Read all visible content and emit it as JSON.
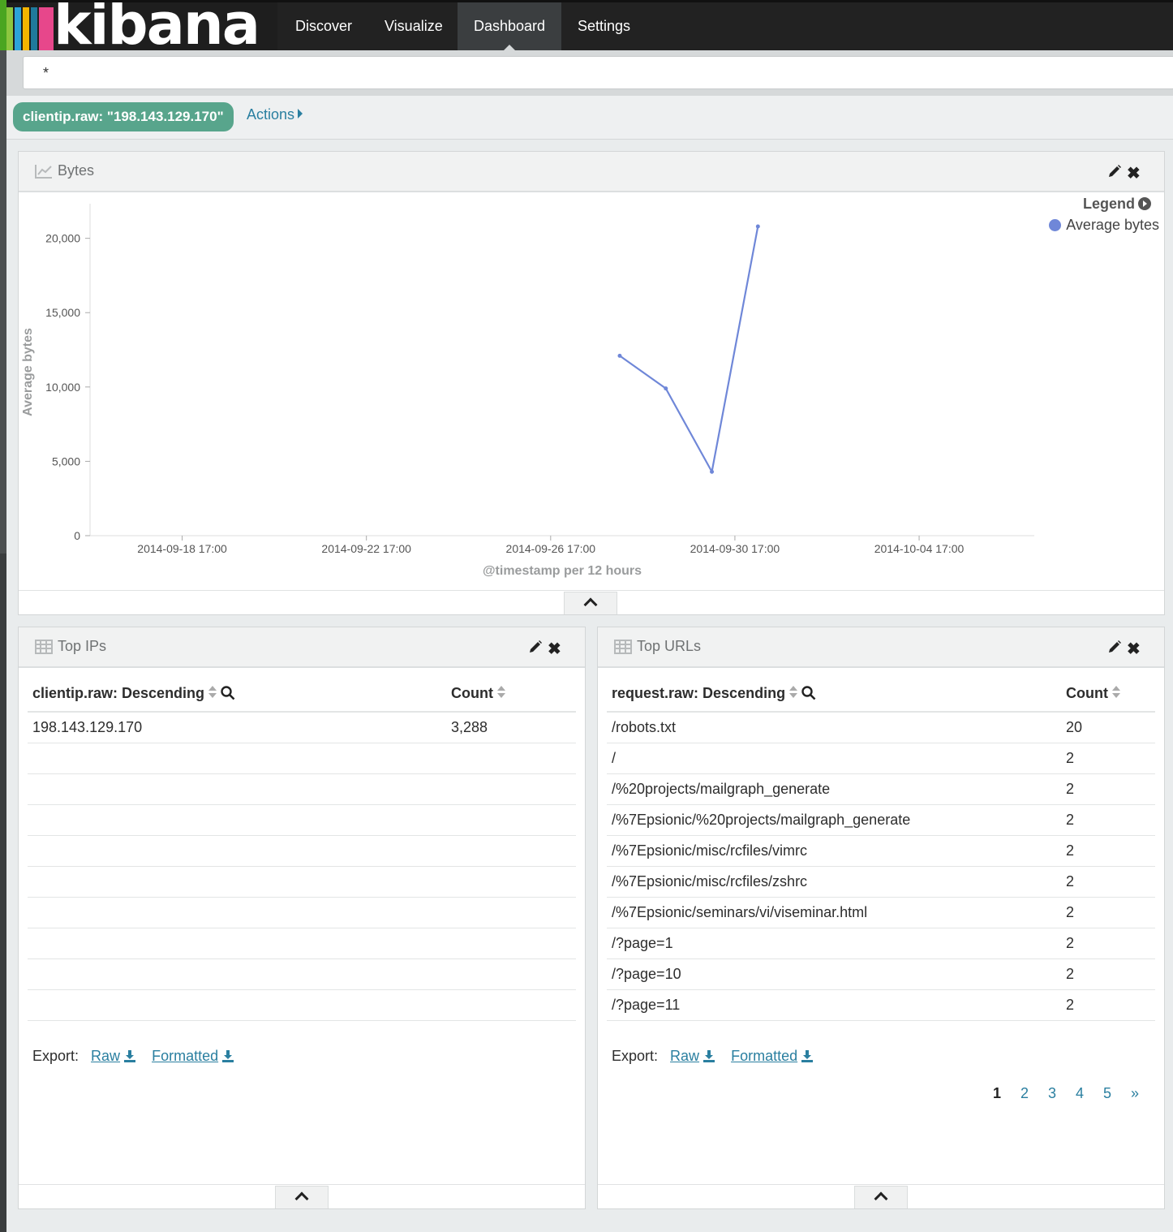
{
  "app": {
    "logo": "kibana"
  },
  "nav": {
    "items": [
      "Discover",
      "Visualize",
      "Dashboard",
      "Settings"
    ],
    "active": "Dashboard"
  },
  "query": {
    "value": "*"
  },
  "filter": {
    "pill": "clientip.raw: \"198.143.129.170\"",
    "actions": "Actions"
  },
  "bytes_panel": {
    "title": "Bytes",
    "legend_title": "Legend",
    "legend_item": "Average bytes"
  },
  "chart_data": {
    "type": "line",
    "title": "Bytes",
    "xlabel": "@timestamp per 12 hours",
    "ylabel": "Average bytes",
    "ylim": [
      0,
      22000
    ],
    "yticks": [
      "0",
      "5,000",
      "10,000",
      "15,000",
      "20,000"
    ],
    "ytick_values": [
      0,
      5000,
      10000,
      15000,
      20000
    ],
    "xticks": [
      "2014-09-18 17:00",
      "2014-09-22 17:00",
      "2014-09-26 17:00",
      "2014-09-30 17:00",
      "2014-10-04 17:00"
    ],
    "xlim": [
      "2014-09-16 17:00",
      "2014-10-07 05:00"
    ],
    "legend": "top-right",
    "series": [
      {
        "name": "Average bytes",
        "color": "#6f87d8",
        "x": [
          "2014-09-28 05:00",
          "2014-09-29 05:00",
          "2014-09-30 05:00",
          "2014-10-01 05:00"
        ],
        "y": [
          12100,
          9900,
          4300,
          20800
        ]
      }
    ]
  },
  "top_ips": {
    "title": "Top IPs",
    "columns": [
      "clientip.raw: Descending",
      "Count"
    ],
    "rows": [
      [
        "198.143.129.170",
        "3,288"
      ]
    ],
    "export_label": "Export:",
    "export_raw": "Raw",
    "export_formatted": "Formatted"
  },
  "top_urls": {
    "title": "Top URLs",
    "columns": [
      "request.raw: Descending",
      "Count"
    ],
    "rows": [
      [
        "/robots.txt",
        "20"
      ],
      [
        "/",
        "2"
      ],
      [
        "/%20projects/mailgraph_generate",
        "2"
      ],
      [
        "/%7Epsionic/%20projects/mailgraph_generate",
        "2"
      ],
      [
        "/%7Epsionic/misc/rcfiles/vimrc",
        "2"
      ],
      [
        "/%7Epsionic/misc/rcfiles/zshrc",
        "2"
      ],
      [
        "/%7Epsionic/seminars/vi/viseminar.html",
        "2"
      ],
      [
        "/?page=1",
        "2"
      ],
      [
        "/?page=10",
        "2"
      ],
      [
        "/?page=11",
        "2"
      ]
    ],
    "export_label": "Export:",
    "export_raw": "Raw",
    "export_formatted": "Formatted",
    "pages": [
      "1",
      "2",
      "3",
      "4",
      "5",
      "»"
    ],
    "current_page": "1"
  }
}
